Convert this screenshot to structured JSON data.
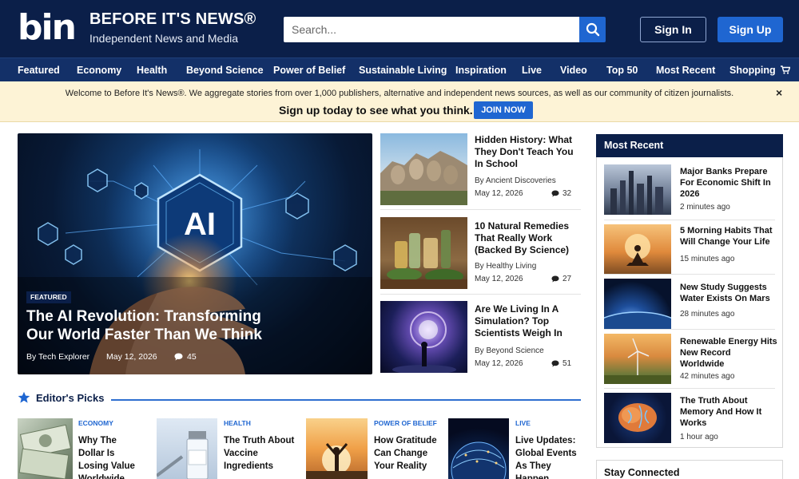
{
  "brand": {
    "logo_text": "bin",
    "name": "BEFORE IT'S NEWS®",
    "tagline": "Independent News and Media"
  },
  "search": {
    "placeholder": "Search..."
  },
  "auth": {
    "sign_in": "Sign In",
    "sign_up": "Sign Up"
  },
  "nav": [
    "Featured",
    "Economy",
    "Health",
    "Beyond Science",
    "Power of Belief",
    "Sustainable Living",
    "Inspiration",
    "Live",
    "Video",
    "Top 50",
    "Most Recent",
    "Shopping"
  ],
  "banner": {
    "message": "Welcome to Before It's News®.  We aggregate stories from over 1,000 publishers, alternative and independent news sources, as well as our community of citizen journalists.",
    "cta": "Sign up today to see what you think.",
    "button": "JOIN NOW",
    "close": "×"
  },
  "hero": {
    "image_text": "AI",
    "tag": "FEATURED",
    "title": "The AI Revolution: Transforming Our World Faster Than We Think",
    "author": "By Tech Explorer",
    "date": "May 12, 2026",
    "comments": "45"
  },
  "stories": [
    {
      "title": "Hidden History: What They Don't Teach You In School",
      "author": "By Ancient Discoveries",
      "date": "May 12, 2026",
      "comments": "32",
      "icon": "mountain-carving-image"
    },
    {
      "title": "10 Natural Remedies That Really Work (Backed By Science)",
      "author": "By Healthy Living",
      "date": "May 12, 2026",
      "comments": "27",
      "icon": "herbal-bottles-image"
    },
    {
      "title": "Are We Living In A Simulation? Top Scientists Weigh In",
      "author": "By Beyond Science",
      "date": "May 12, 2026",
      "comments": "51",
      "icon": "cosmic-portal-image"
    }
  ],
  "most_recent": {
    "heading": "Most Recent",
    "items": [
      {
        "title": "Major Banks Prepare For Economic Shift In 2026",
        "time": "2 minutes ago"
      },
      {
        "title": "5 Morning Habits That Will Change Your Life",
        "time": "15 minutes ago"
      },
      {
        "title": "New Study Suggests Water Exists On Mars",
        "time": "28 minutes ago"
      },
      {
        "title": "Renewable Energy Hits New Record Worldwide",
        "time": "42 minutes ago"
      },
      {
        "title": "The Truth About Memory And How It Works",
        "time": "1 hour ago"
      }
    ]
  },
  "stay_connected": {
    "heading": "Stay Connected"
  },
  "editors_picks": {
    "heading": "Editor's Picks",
    "items": [
      {
        "category": "ECONOMY",
        "title": "Why The Dollar Is Losing Value Worldwide"
      },
      {
        "category": "HEALTH",
        "title": "The Truth About Vaccine Ingredients"
      },
      {
        "category": "POWER OF BELIEF",
        "title": "How Gratitude Can Change Your Reality"
      },
      {
        "category": "LIVE",
        "title": "Live Updates: Global Events As They Happen"
      }
    ]
  },
  "colors": {
    "header_bg": "#0b1f49",
    "nav_bg": "#133068",
    "accent": "#1f66d1",
    "banner_bg": "#fdf3d6"
  }
}
